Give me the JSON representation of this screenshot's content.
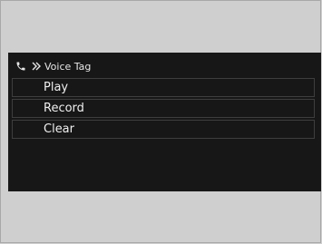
{
  "header": {
    "title": "Voice Tag",
    "icons": [
      "phone-icon",
      "chevron-double-right-icon"
    ]
  },
  "menu": {
    "items": [
      {
        "label": "Play"
      },
      {
        "label": "Record"
      },
      {
        "label": "Clear"
      }
    ]
  },
  "colors": {
    "screen_bg": "#171717",
    "text": "#f0f0f0",
    "border": "#3e3e3e",
    "page_bg": "#cfcfcf"
  }
}
